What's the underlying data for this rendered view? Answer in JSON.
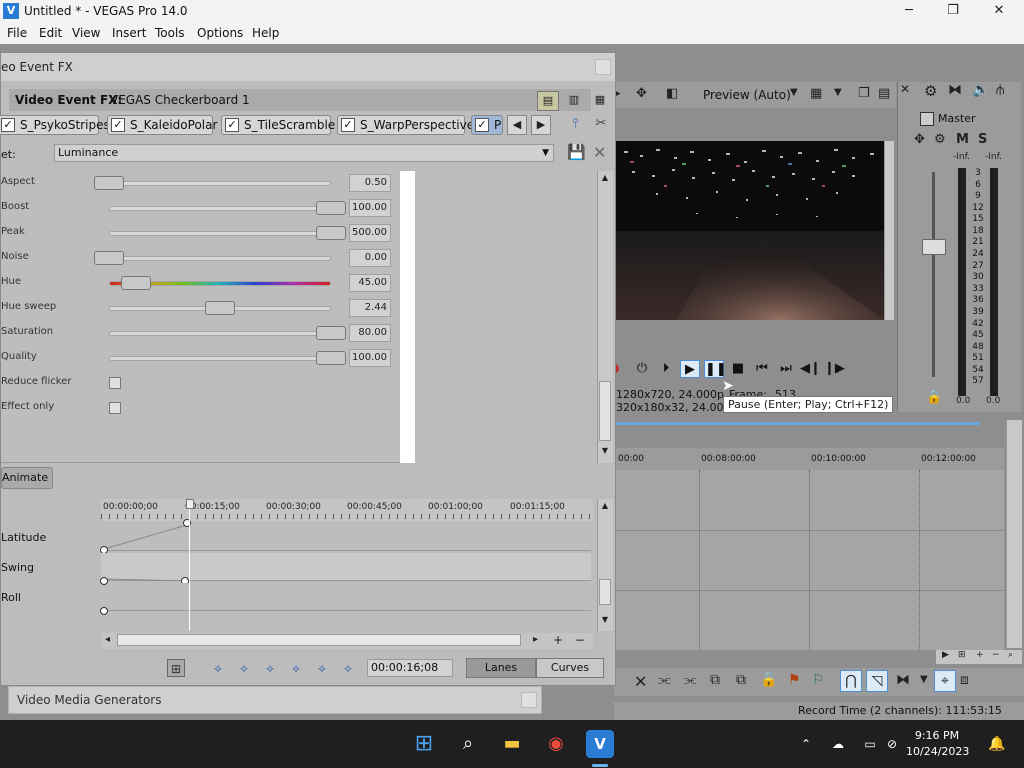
{
  "window": {
    "title": "Untitled * - VEGAS Pro 14.0",
    "minimize": "─",
    "maximize": "❐",
    "close": "✕"
  },
  "menu": [
    "File",
    "Edit",
    "View",
    "Insert",
    "Tools",
    "Options",
    "Help"
  ],
  "fx_window": {
    "title": "eo Event FX",
    "header_label": "Video Event FX:",
    "header_value": "VEGAS Checkerboard 1",
    "plugins": [
      "S_PsykoStripes",
      "S_KaleidoPolar",
      "S_TileScramble",
      "S_WarpPerspective",
      "P"
    ],
    "preset_label": "et:",
    "preset_value": "Luminance",
    "params": [
      {
        "label": "Aspect",
        "value": "0.50",
        "level": 0.0
      },
      {
        "label": "Boost",
        "value": "100.00",
        "level": 1.0
      },
      {
        "label": "Peak",
        "value": "500.00",
        "level": 1.0
      },
      {
        "label": "Noise",
        "value": "0.00",
        "level": 0.0
      },
      {
        "label": "Hue",
        "value": "45.00",
        "level": 0.12
      },
      {
        "label": "Hue sweep",
        "value": "2.44",
        "level": 0.5
      },
      {
        "label": "Saturation",
        "value": "80.00",
        "level": 1.0
      },
      {
        "label": "Quality",
        "value": "100.00",
        "level": 1.0
      }
    ],
    "checkboxes": [
      {
        "label": "Reduce flicker",
        "checked": false
      },
      {
        "label": "Effect only",
        "checked": false
      }
    ],
    "animate_label": "Animate",
    "kf_ruler": [
      "00:00:00;00",
      "00:00:15;00",
      "00:00:30;00",
      "00:00:45;00",
      "00:01:00;00",
      "00:01:15;00"
    ],
    "kf_tracks": [
      "Latitude",
      "Swing",
      "Roll"
    ],
    "kf_time": "00:00:16;08",
    "lanes_label": "Lanes",
    "curves_label": "Curves"
  },
  "preview": {
    "mode": "Preview (Auto)",
    "info_line1": "1280x720, 24.000p",
    "info_line2": "320x180x32, 24.000p",
    "frame_label": "Frame:",
    "frame_value": "513",
    "tooltip": "Pause (Enter; Play; Ctrl+F12)"
  },
  "mixer": {
    "label": "Master",
    "m": "M",
    "s": "S",
    "inf_left": "-Inf.",
    "inf_right": "-Inf.",
    "scale": [
      "3",
      "6",
      "9",
      "12",
      "15",
      "18",
      "21",
      "24",
      "27",
      "30",
      "33",
      "36",
      "39",
      "42",
      "45",
      "48",
      "51",
      "54",
      "57"
    ],
    "bottom_left": "0.0",
    "bottom_right": "0.0"
  },
  "timeline": {
    "ruler": [
      "00:00",
      "00:08:00:00",
      "00:10:00:00",
      "00:12:00:00"
    ]
  },
  "status": {
    "record_time": "Record Time (2 channels): 111:53:15"
  },
  "generators": {
    "title": "Video Media Generators"
  },
  "taskbar": {
    "time": "9:16 PM",
    "date": "10/24/2023"
  },
  "colors": {
    "accent": "#2a7bd3",
    "playhead": "#ffffff"
  }
}
